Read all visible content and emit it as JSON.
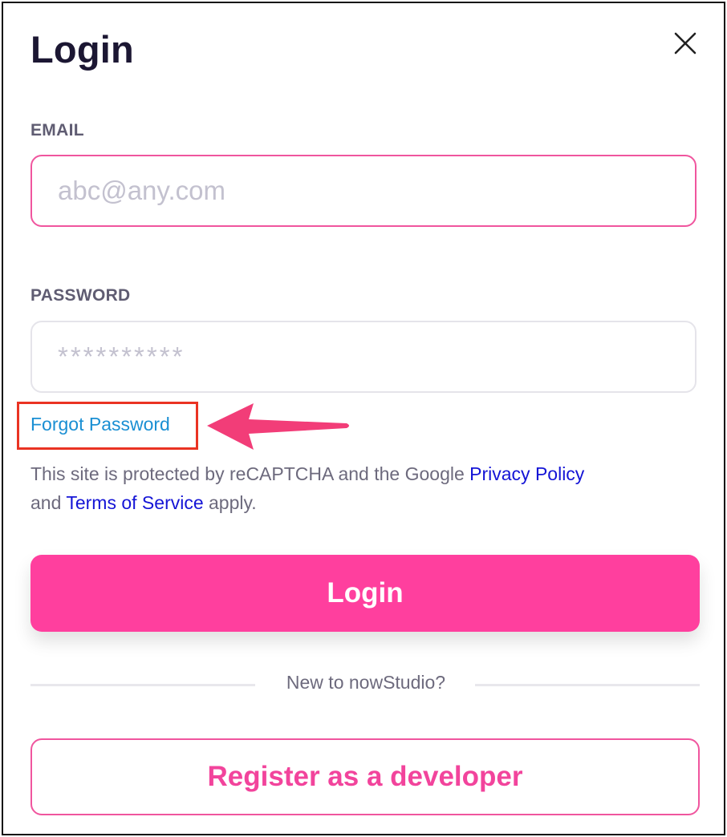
{
  "dialog": {
    "title": "Login",
    "close_icon": "close-icon"
  },
  "email": {
    "label": "EMAIL",
    "value": "",
    "placeholder": "abc@any.com"
  },
  "password": {
    "label": "PASSWORD",
    "value": "",
    "placeholder": "**********"
  },
  "forgot_password": {
    "label": "Forgot Password",
    "highlight_color": "#ea3323",
    "arrow_color": "#f23d78"
  },
  "notice": {
    "text_before": "This site is protected by reCAPTCHA and the Google",
    "privacy_link": "Privacy Policy",
    "text_middle": "and",
    "terms_link": "Terms of Service",
    "text_after": "apply."
  },
  "login_button": {
    "label": "Login"
  },
  "divider": {
    "text": "New to nowStudio?"
  },
  "register_button": {
    "label": "Register as a developer"
  },
  "colors": {
    "accent": "#ff3f9e",
    "title": "#1c1733",
    "link_forgot": "#1a8fd3",
    "link_policy": "#1414d6"
  }
}
